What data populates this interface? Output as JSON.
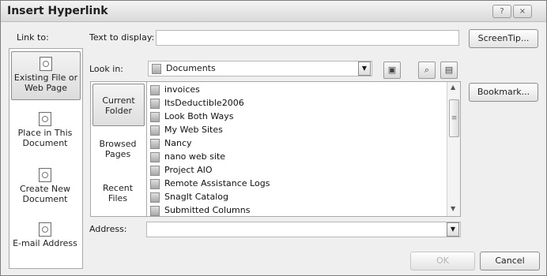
{
  "window": {
    "title": "Insert Hyperlink",
    "help_glyph": "?",
    "close_glyph": "×"
  },
  "link_to": {
    "label": "Link to:",
    "items": [
      {
        "label": "Existing File or Web Page",
        "icon": "existing-file-icon"
      },
      {
        "label": "Place in This Document",
        "icon": "place-in-document-icon"
      },
      {
        "label": "Create New Document",
        "icon": "new-document-icon"
      },
      {
        "label": "E-mail Address",
        "icon": "email-icon"
      }
    ]
  },
  "text_to_display": {
    "label": "Text to display:",
    "value": ""
  },
  "screen_tip_label": "ScreenTip...",
  "look_in": {
    "label": "Look in:",
    "value": "Documents"
  },
  "views": [
    {
      "label": "Current Folder"
    },
    {
      "label": "Browsed Pages"
    },
    {
      "label": "Recent Files"
    }
  ],
  "files": [
    "invoices",
    "ItsDeductible2006",
    "Look Both Ways",
    "My Web Sites",
    "Nancy",
    "nano web site",
    "Project AIO",
    "Remote Assistance Logs",
    "SnagIt Catalog",
    "Submitted Columns"
  ],
  "bookmark_label": "Bookmark...",
  "address": {
    "label": "Address:",
    "value": ""
  },
  "ok_label": "OK",
  "cancel_label": "Cancel"
}
